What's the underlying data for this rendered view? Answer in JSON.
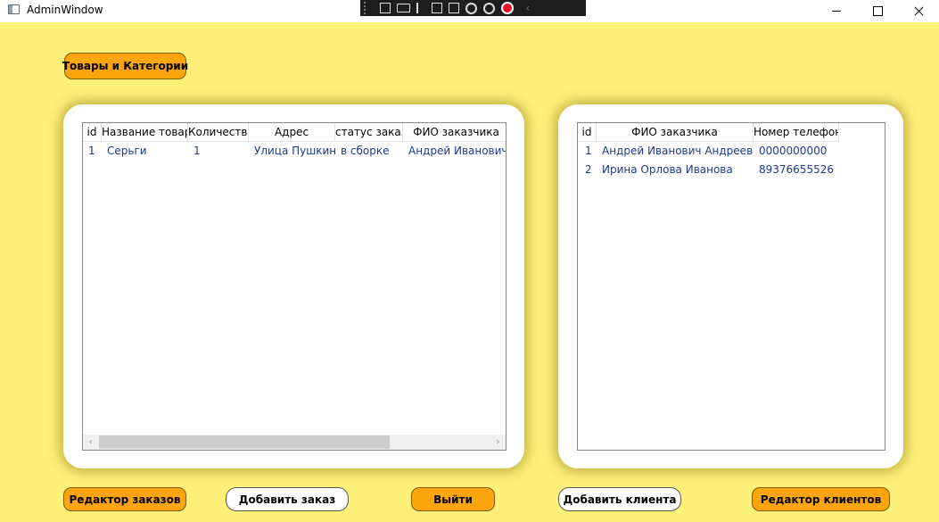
{
  "window": {
    "title": "AdminWindow"
  },
  "top_button": {
    "label": "Товары и Категории"
  },
  "orders_grid": {
    "columns": [
      "id",
      "Название товара",
      "Количество",
      "Адрес",
      "статус заказа",
      "ФИО заказчика"
    ],
    "rows": [
      [
        "1",
        "Серьги",
        "1",
        "Улица Пушкина",
        "в сборке",
        "Андрей Иванович Андреевич"
      ]
    ]
  },
  "clients_grid": {
    "columns": [
      "id",
      "ФИО заказчика",
      "Номер телефона"
    ],
    "rows": [
      [
        "1",
        "Андрей Иванович Андреевич",
        "0000000000"
      ],
      [
        "2",
        "Ирина Орлова Иванова",
        "89376655526"
      ]
    ]
  },
  "bottom_buttons": {
    "edit_orders": "Редактор заказов",
    "add_order": "Добавить заказ",
    "exit": "Выйти",
    "add_client": "Добавить клиента",
    "edit_clients": "Редактор клиентов"
  },
  "colors": {
    "background": "#fef17a",
    "accent_button": "#fea40c",
    "cell_text": "#1b3a8a"
  }
}
